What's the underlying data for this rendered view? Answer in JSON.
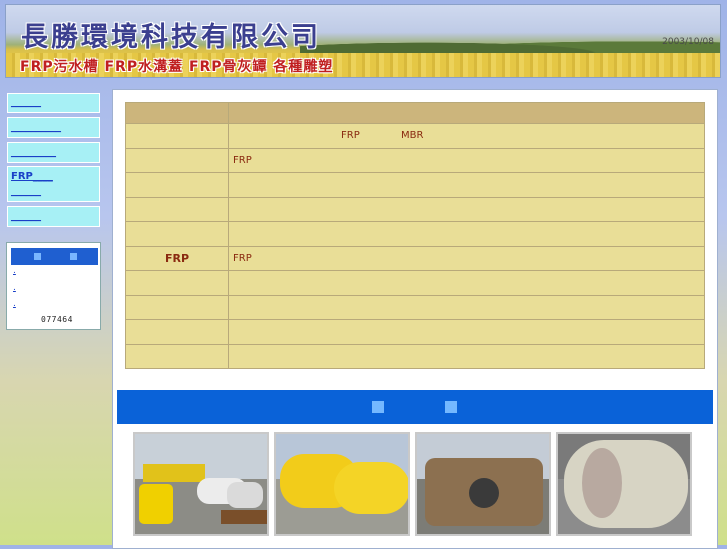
{
  "header": {
    "company_name": "長勝環境科技有限公司",
    "tagline": "FRP污水槽 FRP水溝蓋 FRP骨灰罈 各種雕塑",
    "banner_mark": "2003/10/08"
  },
  "sidebar": {
    "items": [
      {
        "label": "______"
      },
      {
        "label": "__________"
      },
      {
        "label": "_________"
      },
      {
        "label": "FRP____",
        "sub": "______"
      },
      {
        "label": "______"
      }
    ],
    "counter": {
      "links": [
        ".",
        ".",
        "."
      ],
      "count": "077464"
    }
  },
  "spec_table": {
    "rows": [
      {
        "c1": "",
        "c2": ""
      },
      {
        "c1": "",
        "c2": "FRP             MBR"
      },
      {
        "c1": "",
        "c2": "FRP"
      },
      {
        "c1": "",
        "c2": ""
      },
      {
        "c1": "",
        "c2": ""
      },
      {
        "c1": "",
        "c2": ""
      },
      {
        "c1": "FRP",
        "c2": "FRP"
      },
      {
        "c1": "",
        "c2": ""
      },
      {
        "c1": "",
        "c2": ""
      },
      {
        "c1": "",
        "c2": ""
      },
      {
        "c1": "",
        "c2": ""
      }
    ]
  },
  "photos": [
    {
      "name": "photo-yellow-tanks-site"
    },
    {
      "name": "photo-yellow-cylinder-tanks"
    },
    {
      "name": "photo-large-frp-ring"
    },
    {
      "name": "photo-frp-pipe-section"
    }
  ],
  "colors": {
    "accent_blue": "#0a62d8",
    "table_head": "#ccb57c",
    "table_row": "#e9de97",
    "sidebar_item": "#a7f0f5",
    "text_brown": "#8a2a10"
  }
}
